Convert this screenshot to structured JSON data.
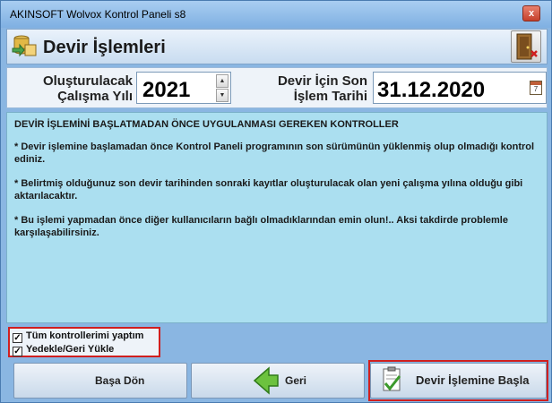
{
  "window": {
    "title": "AKINSOFT Wolvox Kontrol Paneli s8",
    "close_label": "x"
  },
  "header": {
    "title": "Devir İşlemleri"
  },
  "form": {
    "year_label_line1": "Oluşturulacak",
    "year_label_line2": "Çalışma Yılı",
    "year_value": "2021",
    "date_label_line1": "Devir İçin Son",
    "date_label_line2": "İşlem Tarihi",
    "date_value": "31.12.2020",
    "calendar_day": "7"
  },
  "info": {
    "heading": "DEVİR İŞLEMİNİ BAŞLATMADAN ÖNCE UYGULANMASI GEREKEN KONTROLLER",
    "item1": "* Devir işlemine başlamadan önce Kontrol Paneli programının son sürümünün yüklenmiş olup olmadığı kontrol ediniz.",
    "item2": "* Belirtmiş olduğunuz son devir tarihinden sonraki kayıtlar oluşturulacak olan yeni çalışma yılına olduğu gibi aktarılacaktır.",
    "item3": "* Bu işlemi yapmadan önce diğer kullanıcıların bağlı olmadıklarından emin olun!.. Aksi takdirde problemle karşılaşabilirsiniz."
  },
  "checks": {
    "all_checked_label": "Tüm kontrollerimi yaptım",
    "backup_label": "Yedekle/Geri Yükle",
    "all_checked": true,
    "backup": true
  },
  "buttons": {
    "home_label": "Başa Dön",
    "back_label": "Geri",
    "start_label": "Devir İşlemine Başla"
  },
  "colors": {
    "info_bg": "#abdff0",
    "highlight": "#d01f1f"
  }
}
